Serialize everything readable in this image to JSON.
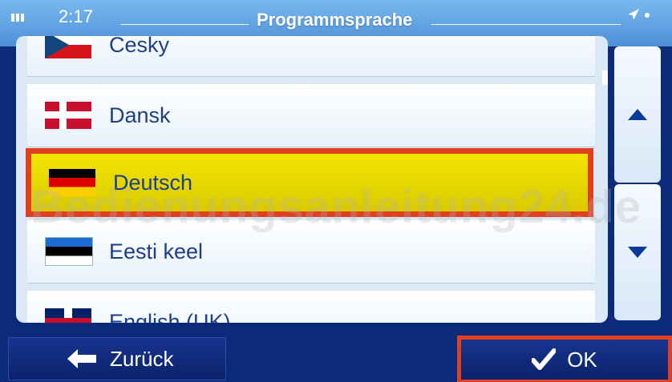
{
  "status": {
    "time": "2:17",
    "title": "Programmsprache"
  },
  "languages": [
    {
      "label": "Česky",
      "flag": "czech-flag"
    },
    {
      "label": "Dansk",
      "flag": "danish-flag"
    },
    {
      "label": "Deutsch",
      "flag": "german-flag",
      "selected": true
    },
    {
      "label": "Eesti keel",
      "flag": "estonian-flag"
    },
    {
      "label": "English (UK)",
      "flag": "uk-flag"
    }
  ],
  "footer": {
    "back_label": "Zurück",
    "ok_label": "OK"
  },
  "watermark": "Bedienungsanleitung24.de",
  "colors": {
    "selection": "#f2e400",
    "highlight_border": "#e04020",
    "accent": "#0b3a9b"
  }
}
